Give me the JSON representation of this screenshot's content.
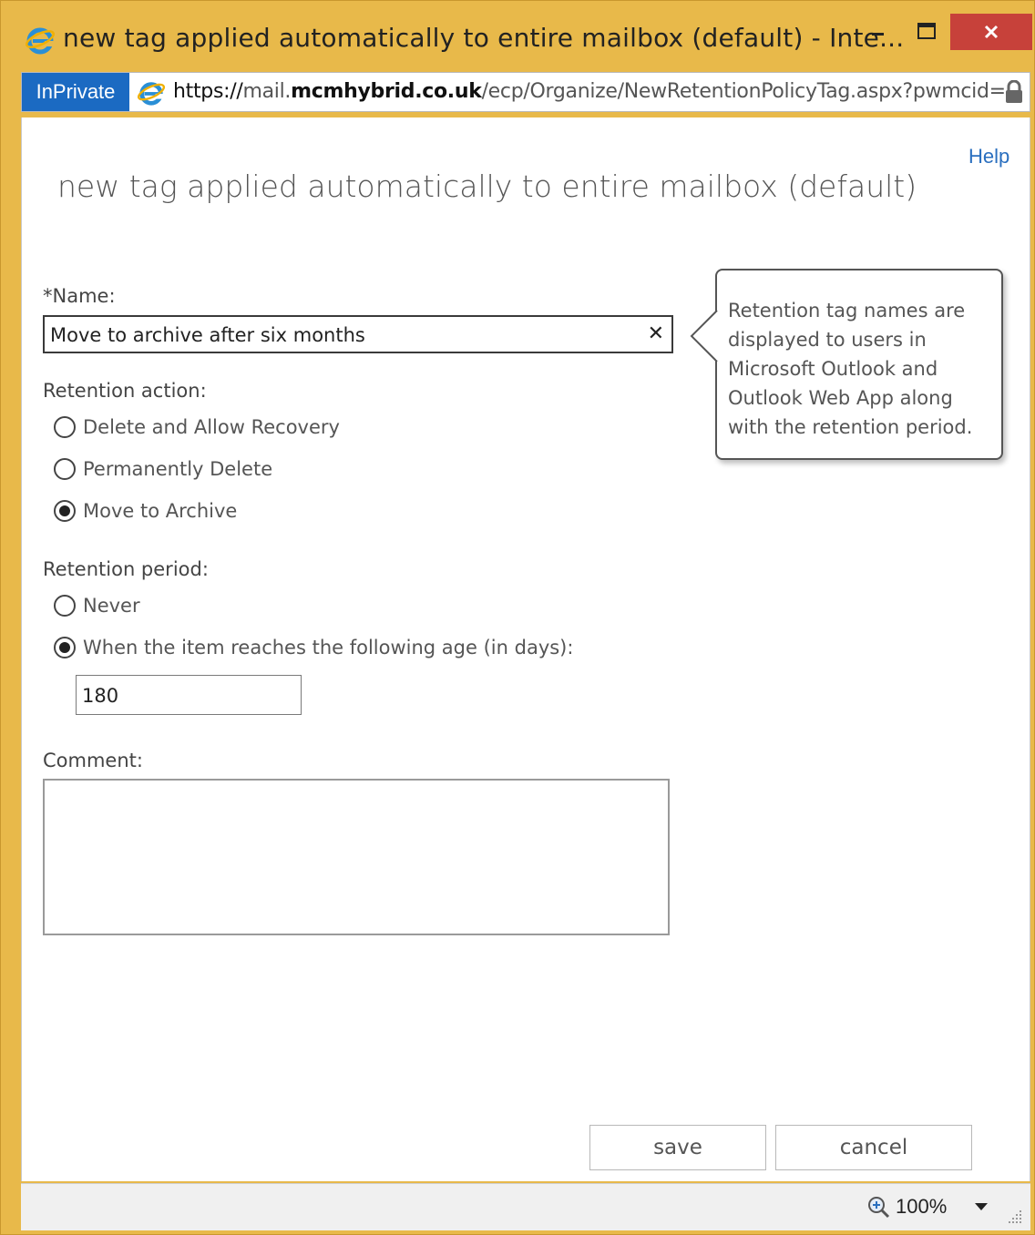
{
  "window": {
    "title": "new tag applied automatically to entire mailbox (default) - Inte...",
    "minimize_icon": "minimize-icon",
    "maximize_icon": "maximize-icon",
    "close_icon": "close-icon"
  },
  "address_bar": {
    "inprivate_label": "InPrivate",
    "url_scheme": "https://",
    "url_prefix": "mail.",
    "url_host": "mcmhybrid.co.uk",
    "url_path": "/ecp/Organize/NewRetentionPolicyTag.aspx?pwmcid=",
    "lock_icon": "lock-icon"
  },
  "page": {
    "help_link": "Help",
    "title": "new tag applied automatically to entire mailbox (default)"
  },
  "form": {
    "name_label": "*Name:",
    "name_value": "Move to archive after six months",
    "clear_glyph": "✕",
    "retention_action_label": "Retention action:",
    "retention_actions": [
      {
        "label": "Delete and Allow Recovery",
        "selected": false
      },
      {
        "label": "Permanently Delete",
        "selected": false
      },
      {
        "label": "Move to Archive",
        "selected": true
      }
    ],
    "retention_period_label": "Retention period:",
    "retention_periods": [
      {
        "label": "Never",
        "selected": false
      },
      {
        "label": "When the item reaches the following age (in days):",
        "selected": true
      }
    ],
    "age_days_value": "180",
    "comment_label": "Comment:",
    "comment_value": ""
  },
  "tooltip": {
    "text": "Retention tag names are displayed to users in Microsoft Outlook and Outlook Web App along with the retention period."
  },
  "buttons": {
    "save_label": "save",
    "cancel_label": "cancel"
  },
  "status_bar": {
    "zoom_level": "100%"
  },
  "colors": {
    "frame": "#e8b94a",
    "close_button": "#c7413a",
    "inprivate_badge": "#1b6ac2",
    "link": "#2a6fbf"
  }
}
